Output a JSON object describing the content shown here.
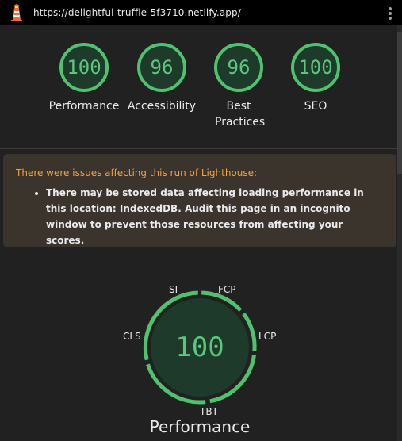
{
  "browser": {
    "url": "https://delightful-truffle-5f3710.netlify.app/",
    "icons": {
      "site": "lighthouse-icon",
      "menu": "more-vert-icon"
    }
  },
  "colors": {
    "pass": "#0cce6b",
    "warning_bg": "#3a342d",
    "warning_title": "#f5a041",
    "background": "#212121"
  },
  "scores": [
    {
      "value": "100",
      "label": "Performance",
      "score": 100
    },
    {
      "value": "96",
      "label": "Accessibility",
      "score": 96
    },
    {
      "value": "96",
      "label": "Best Practices",
      "score": 96
    },
    {
      "value": "100",
      "label": "SEO",
      "score": 100
    }
  ],
  "warning": {
    "title": "There were issues affecting this run of Lighthouse:",
    "items": [
      "There may be stored data affecting loading performance in this location: IndexedDB. Audit this page in an incognito window to prevent those resources from affecting your scores."
    ]
  },
  "performance_gauge": {
    "value": "100",
    "label": "Performance",
    "metrics": {
      "si": "SI",
      "fcp": "FCP",
      "lcp": "LCP",
      "tbt": "TBT",
      "cls": "CLS"
    }
  }
}
